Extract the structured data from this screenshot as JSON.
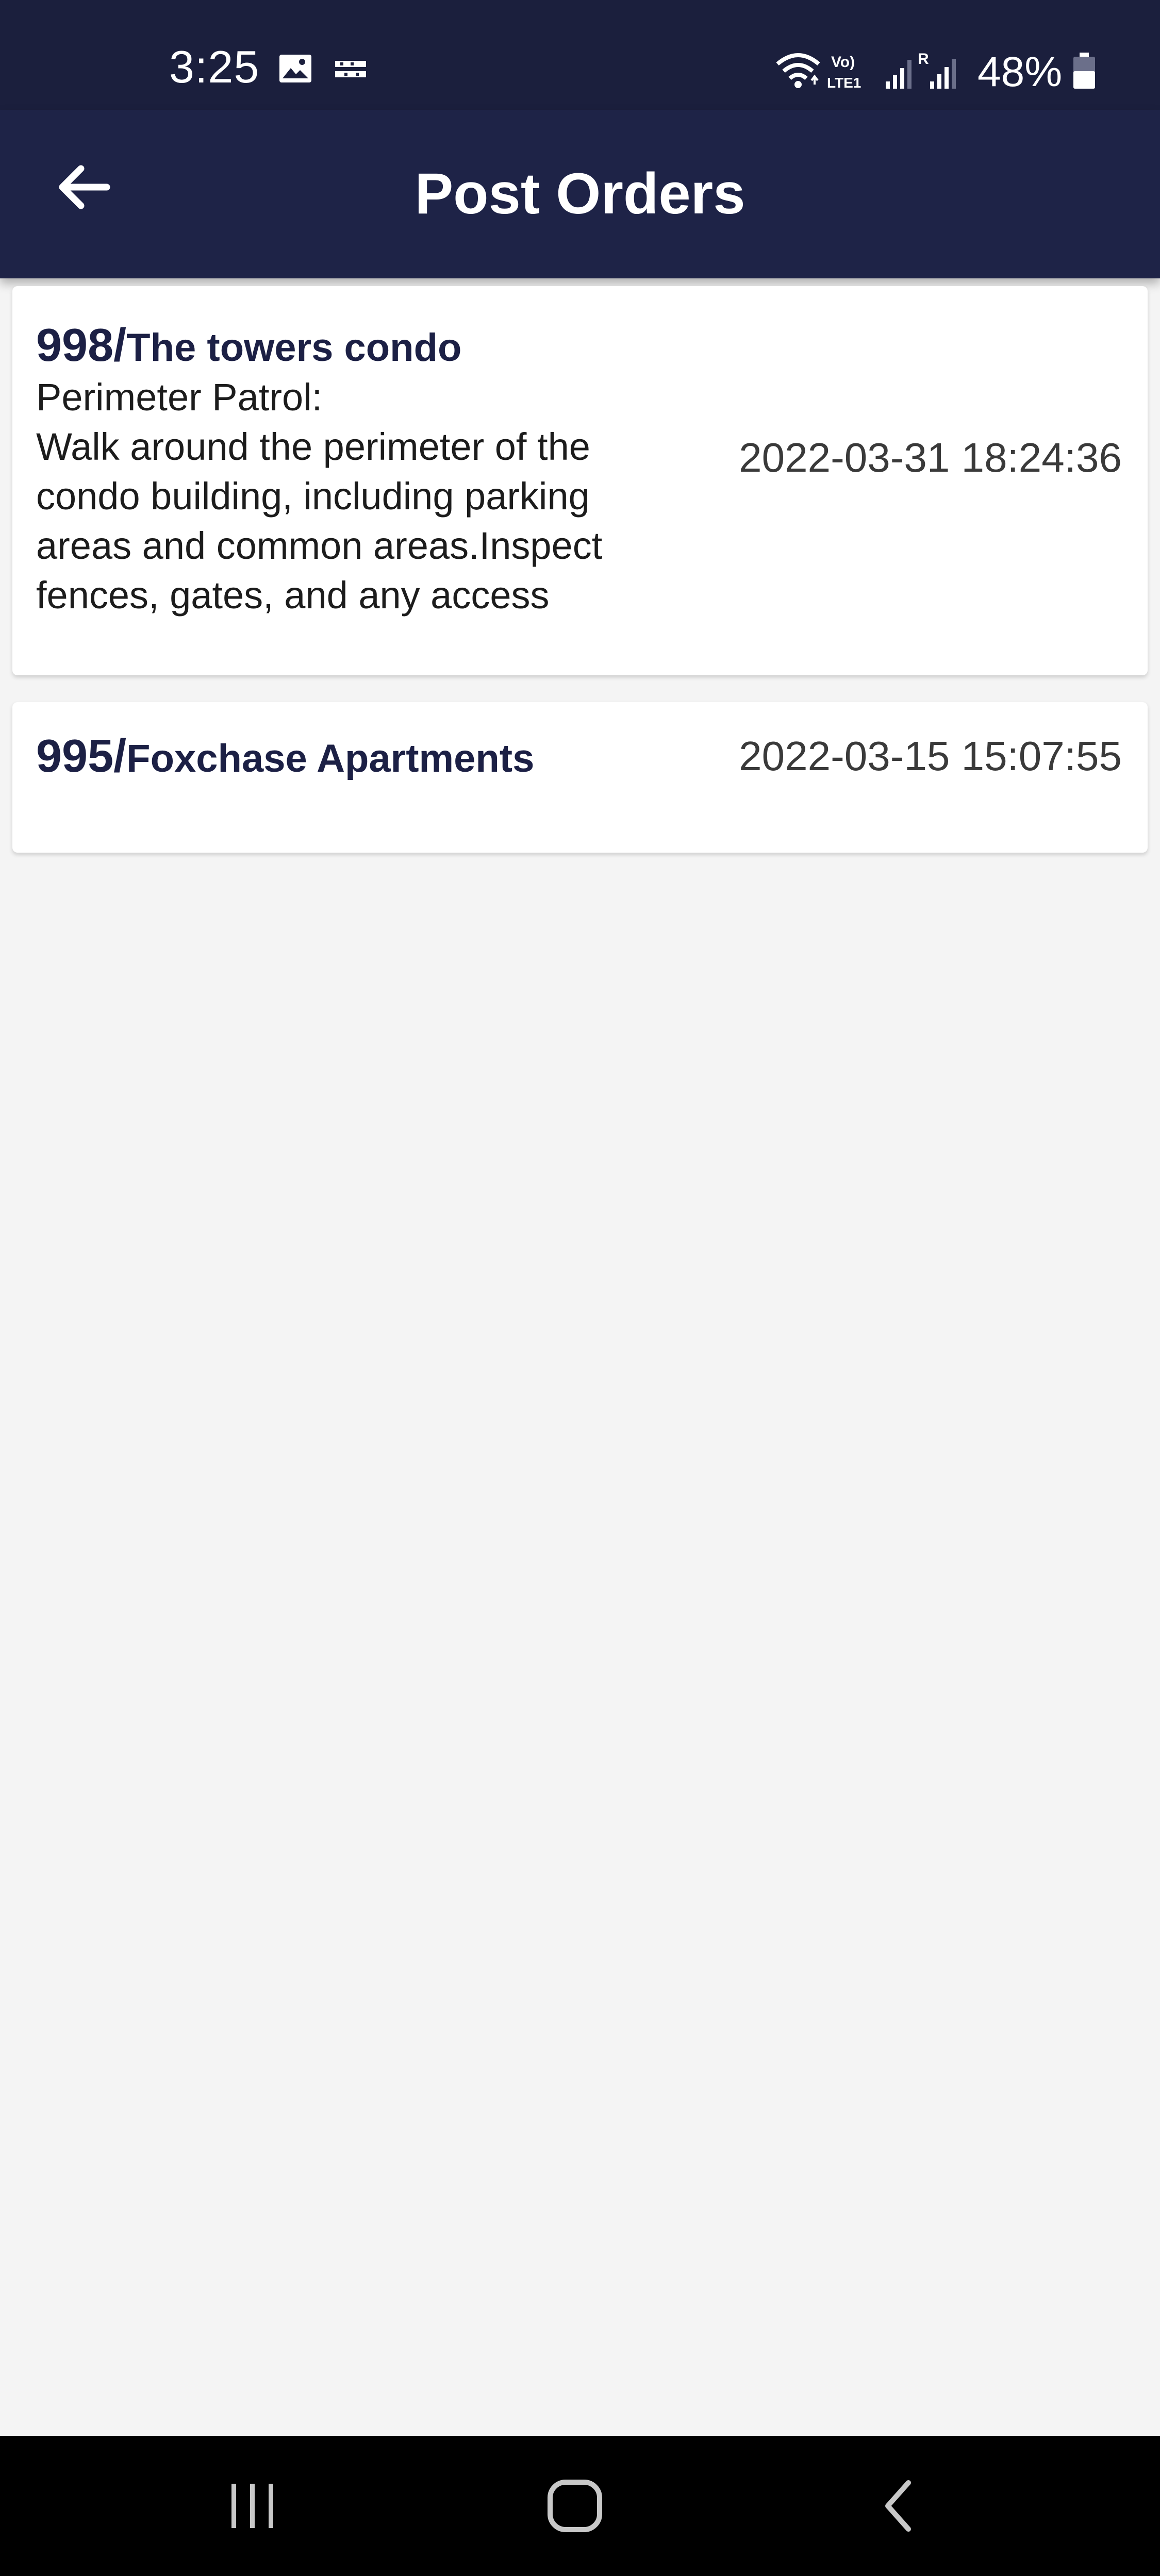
{
  "status_bar": {
    "time": "3:25",
    "battery": "48%",
    "icons": [
      "image-icon",
      "tata-play-icon",
      "wifi-icon",
      "volte-icon",
      "signal-icon",
      "roaming-signal-icon",
      "battery-icon"
    ]
  },
  "app_bar": {
    "title": "Post Orders",
    "back_icon": "arrow-left-icon"
  },
  "post_orders": [
    {
      "number": "998/",
      "name": "The towers condo",
      "description": "Perimeter Patrol:\nWalk around the perimeter of the\ncondo building, including parking\nareas and common areas.Inspect\nfences, gates, and any access",
      "datetime": "2022-03-31 18:24:36"
    },
    {
      "number": "995/",
      "name": "Foxchase Apartments",
      "datetime": "2022-03-15 15:07:55"
    }
  ],
  "nav_bar": {
    "buttons": [
      "recents-icon",
      "home-icon",
      "back-icon"
    ]
  },
  "colors": {
    "status_bar": "#1b1f3d",
    "app_bar": "#1e2347",
    "background": "#f4f4f4",
    "title_text": "#1c2045"
  }
}
